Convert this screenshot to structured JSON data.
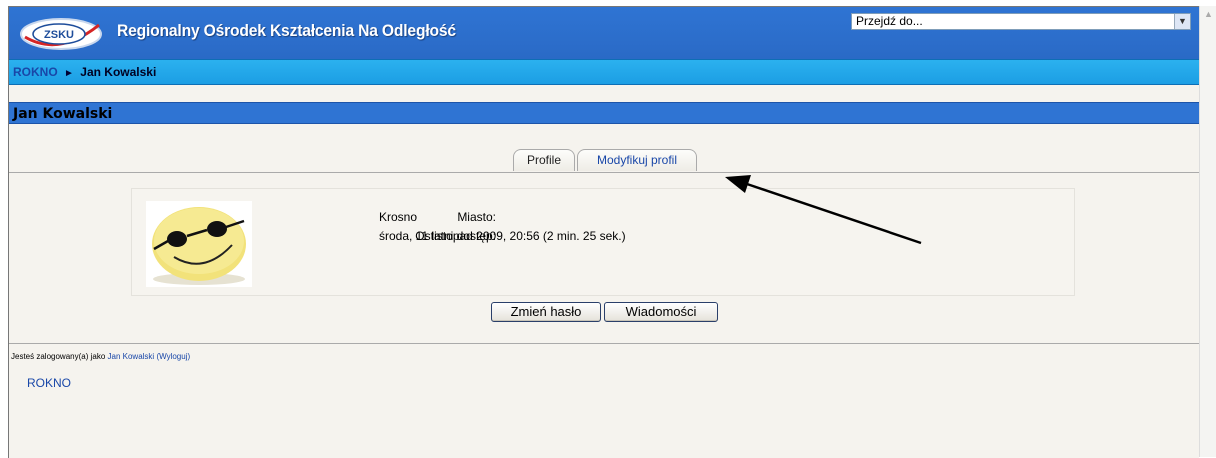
{
  "header": {
    "logo_text": "ZSKU",
    "site_title": "Regionalny Ośrodek Kształcenia Na Odległość",
    "jump_placeholder": "Przejdź do..."
  },
  "breadcrumb": {
    "home": "ROKNO",
    "separator": "►",
    "current": "Jan Kowalski"
  },
  "page_title": "Jan Kowalski",
  "tabs": [
    {
      "label": "Profile",
      "active": true
    },
    {
      "label": "Modyfikuj profil",
      "active": false
    }
  ],
  "profile": {
    "city_label": "Miasto:",
    "city_value": "Krosno",
    "last_access_label": "Ostatni dostęp:",
    "last_access_value": "środa, 11 listopad 2009, 20:56  (2 min. 25 sek.)",
    "avatar_icon": "smiley-sunglasses-icon"
  },
  "buttons": {
    "change_password": "Zmień hasło",
    "messages": "Wiadomości"
  },
  "footer": {
    "logged_in_prefix": "Jesteś zalogowany(a) jako",
    "user_name": "Jan Kowalski",
    "logout": "(Wyloguj)",
    "home_link": "ROKNO"
  },
  "colors": {
    "header_blue": "#2f74d3",
    "nav_cyan": "#1ea6e8",
    "link_blue": "#1947a8",
    "page_bg": "#f5f3ee"
  }
}
